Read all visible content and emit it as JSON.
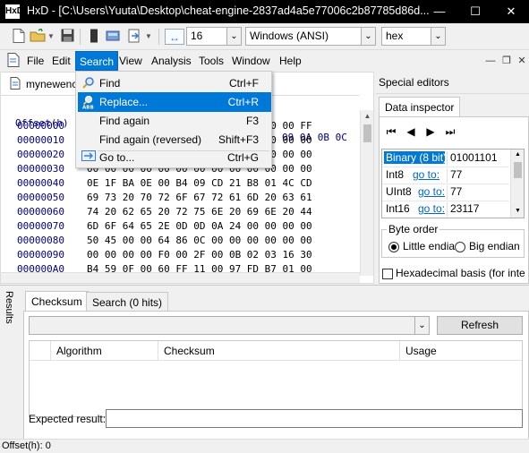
{
  "window": {
    "app_icon": "HxD",
    "title": "HxD - [C:\\Users\\Yuuta\\Desktop\\cheat-engine-2837ad4a5e77006c2b87785d86d...",
    "minimize": "—",
    "maximize": "☐",
    "close": "✕"
  },
  "toolbar": {
    "bytes_per_row": "16",
    "charset": "Windows (ANSI)",
    "display_mode": "hex",
    "bytes_icon": "↔"
  },
  "menubar": {
    "items": [
      "File",
      "Edit",
      "Search",
      "View",
      "Analysis",
      "Tools",
      "Window",
      "Help"
    ],
    "active": "Search"
  },
  "search_menu": {
    "items": [
      {
        "label": "Find",
        "shortcut": "Ctrl+F",
        "icon": "find-icon"
      },
      {
        "label": "Replace...",
        "shortcut": "Ctrl+R",
        "icon": "replace-icon",
        "highlighted": true
      },
      {
        "label": "Find again",
        "shortcut": "F3",
        "icon": ""
      },
      {
        "label": "Find again (reversed)",
        "shortcut": "Shift+F3",
        "icon": ""
      },
      {
        "label": "Go to...",
        "shortcut": "Ctrl+G",
        "icon": "goto-icon"
      }
    ]
  },
  "document": {
    "tab_name": "mynewenc",
    "offset_header_label": "Offset(h)",
    "column_header_partial": "09 0A 0B 0C",
    "rows": [
      {
        "offset": "00000000",
        "bytes": "4D 5A 90 00 03 00 00 00 04 00 00 00 FF"
      },
      {
        "offset": "00000010",
        "bytes": "B8 00 00 00 00 00 00 00 40 00 00 00 00"
      },
      {
        "offset": "00000020",
        "bytes": "00 00 00 00 00 00 00 00 00 00 00 00 00"
      },
      {
        "offset": "00000030",
        "bytes": "00 00 00 00 00 00 00 00 00 00 00 00 00"
      },
      {
        "offset": "00000040",
        "bytes": "0E 1F BA 0E 00 B4 09 CD 21 B8 01 4C CD"
      },
      {
        "offset": "00000050",
        "bytes": "69 73 20 70 72 6F 67 72 61 6D 20 63 61"
      },
      {
        "offset": "00000060",
        "bytes": "74 20 62 65 20 72 75 6E 20 69 6E 20 44"
      },
      {
        "offset": "00000070",
        "bytes": "6D 6F 64 65 2E 0D 0D 0A 24 00 00 00 00"
      },
      {
        "offset": "00000080",
        "bytes": "50 45 00 00 64 86 0C 00 00 00 00 00 00"
      },
      {
        "offset": "00000090",
        "bytes": "00 00 00 00 F0 00 2F 00 0B 02 03 16 30"
      },
      {
        "offset": "000000A0",
        "bytes": "B4 59 0F 00 60 FF 11 00 97 FD B7 01 00"
      }
    ]
  },
  "special_editors": {
    "title": "Special editors",
    "tab": "Data inspector",
    "nav": [
      "⏮",
      "◀",
      "▶",
      "⏭"
    ],
    "rows": [
      {
        "type": "Binary (8 bit)",
        "link": "",
        "value": "01001101"
      },
      {
        "type": "Int8",
        "link": "go to:",
        "value": "77"
      },
      {
        "type": "UInt8",
        "link": "go to:",
        "value": "77"
      },
      {
        "type": "Int16",
        "link": "go to:",
        "value": "23117"
      }
    ],
    "byte_order_label": "Byte order",
    "little_endian": "Little endian",
    "big_endian": "Big endian",
    "hex_basis": "Hexadecimal basis (for inte"
  },
  "results": {
    "side_label": "Results",
    "tabs": [
      "Checksum",
      "Search (0 hits)"
    ],
    "refresh": "Refresh",
    "columns": [
      "Algorithm",
      "Checksum",
      "Usage"
    ],
    "expected_label": "Expected result:"
  },
  "statusbar": {
    "text": "Offset(h): 0"
  },
  "colors": {
    "accent": "#0078d7",
    "offset_blue": "#00007f",
    "titlebar": "#000000"
  }
}
